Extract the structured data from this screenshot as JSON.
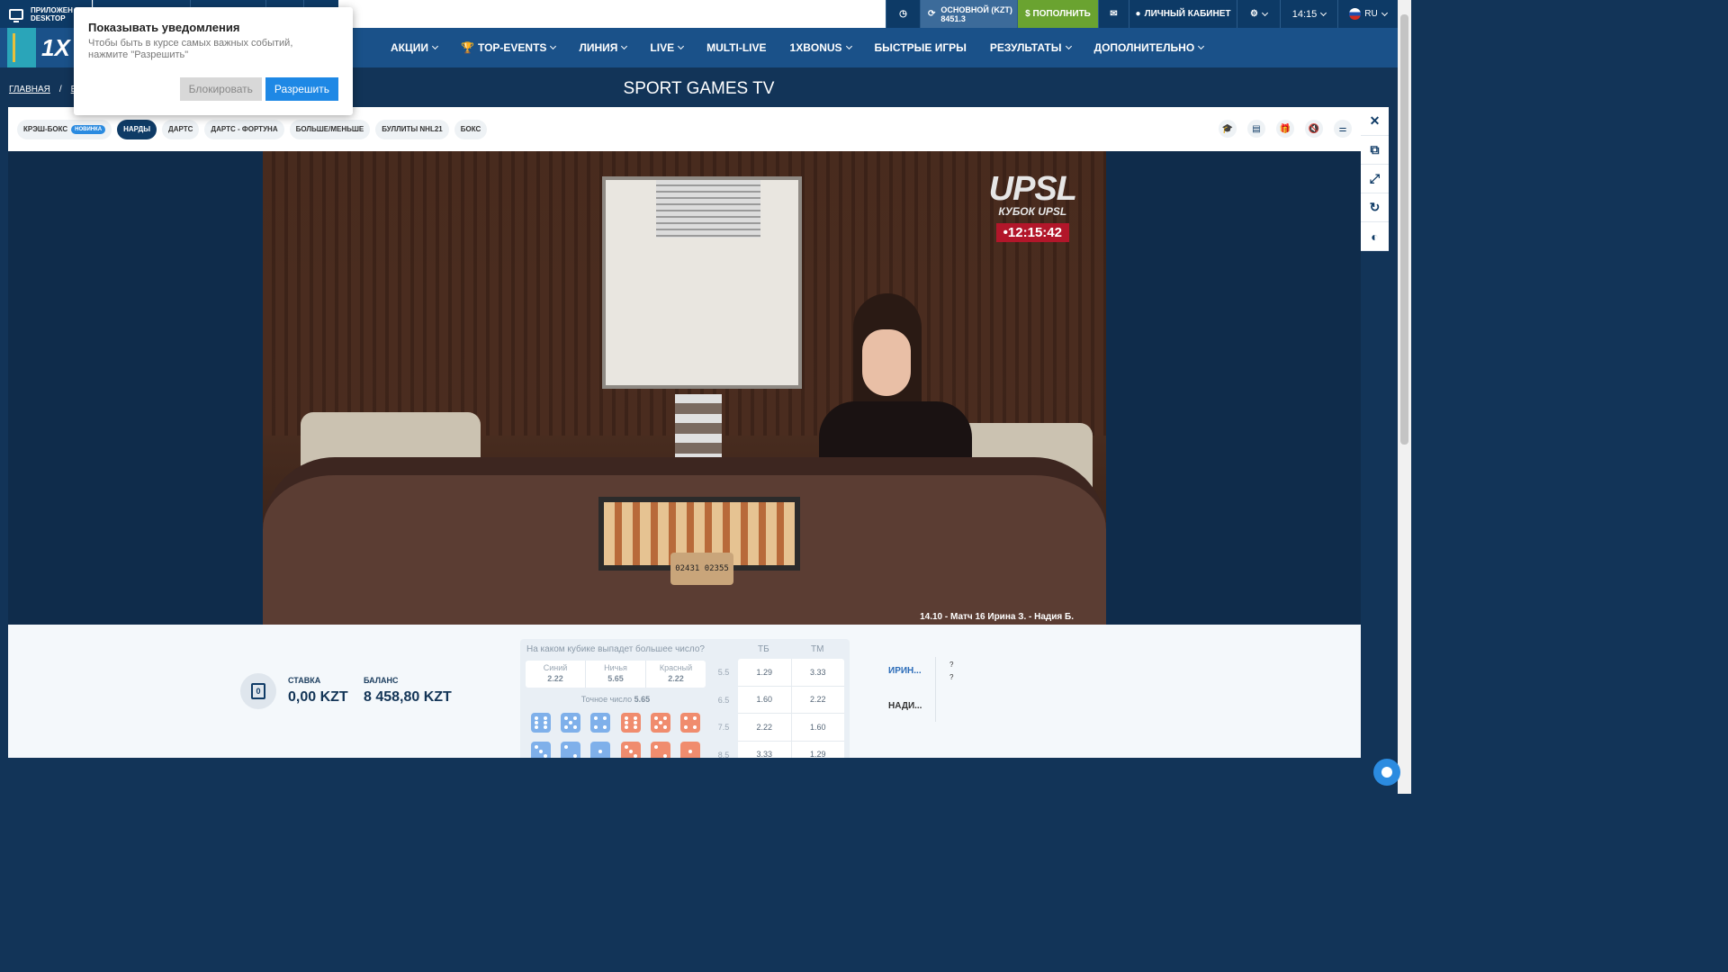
{
  "topbar": {
    "app_desktop_label_1": "ПРИЛОЖЕН",
    "app_desktop_label_2": "DESKTOP",
    "balance_label": "ОСНОВНОЙ (KZT)",
    "balance_value": "8451.3",
    "deposit_label": "$ ПОПОЛНИТЬ",
    "cabinet_label": "ЛИЧНЫЙ КАБИНЕТ",
    "time": "14:15",
    "lang": "RU"
  },
  "logo": {
    "text": "1X"
  },
  "nav": {
    "items": [
      "АКЦИИ",
      "TOP-EVENTS",
      "ЛИНИЯ",
      "LIVE",
      "MULTI-LIVE",
      "1XBONUS",
      "БЫСТРЫЕ ИГРЫ",
      "РЕЗУЛЬТАТЫ",
      "ДОПОЛНИТЕЛЬНО"
    ]
  },
  "breadcrumb": {
    "home": "ГЛАВНАЯ",
    "sep": "/",
    "next": "БЫ"
  },
  "page_title": "SPORT GAMES TV",
  "notification": {
    "title": "Показывать уведомления",
    "text": "Чтобы быть в курсе самых важных событий, нажмите \"Разрешить\"",
    "block_label": "Блокировать",
    "allow_label": "Разрешить"
  },
  "tabs": {
    "items": [
      "КРЭШ-БОКС",
      "НАРДЫ",
      "ДАРТС",
      "ДАРТС - ФОРТУНА",
      "БОЛЬШЕ/МЕНЬШЕ",
      "БУЛЛИТЫ NHL21",
      "БОКС"
    ],
    "new_badge": "НОВИНКА",
    "active_index": 1
  },
  "video": {
    "brand": "UPSL",
    "cup": "КУБОК UPSL",
    "live_time": "•12:15:42",
    "clock_display": "02431 02355",
    "caption": "14.10 - Матч 16 Ирина З. - Надия Б."
  },
  "bet": {
    "stake_label": "СТАВКА",
    "stake_value": "0,00 KZT",
    "balance_label": "БАЛАНС",
    "balance_value": "8 458,80 KZT",
    "wallet_digit": "0"
  },
  "odds": {
    "question": "На каком кубике выпадет большее число?",
    "col_over": "ТБ",
    "col_under": "ТМ",
    "colors": [
      {
        "name": "Синий",
        "value": "2.22"
      },
      {
        "name": "Ничья",
        "value": "5.65"
      },
      {
        "name": "Красный",
        "value": "2.22"
      }
    ],
    "exact_label": "Точное число",
    "exact_value": "5.65",
    "lines": [
      "5.5",
      "6.5",
      "7.5",
      "8.5"
    ],
    "rows": [
      {
        "over": "1.29",
        "under": "3.33"
      },
      {
        "over": "1.60",
        "under": "2.22"
      },
      {
        "over": "2.22",
        "under": "1.60"
      },
      {
        "over": "3.33",
        "under": "1.29"
      }
    ]
  },
  "players": {
    "p1": "ИРИН...",
    "p2": "НАДИ...",
    "q1": "?",
    "q2": "?"
  }
}
